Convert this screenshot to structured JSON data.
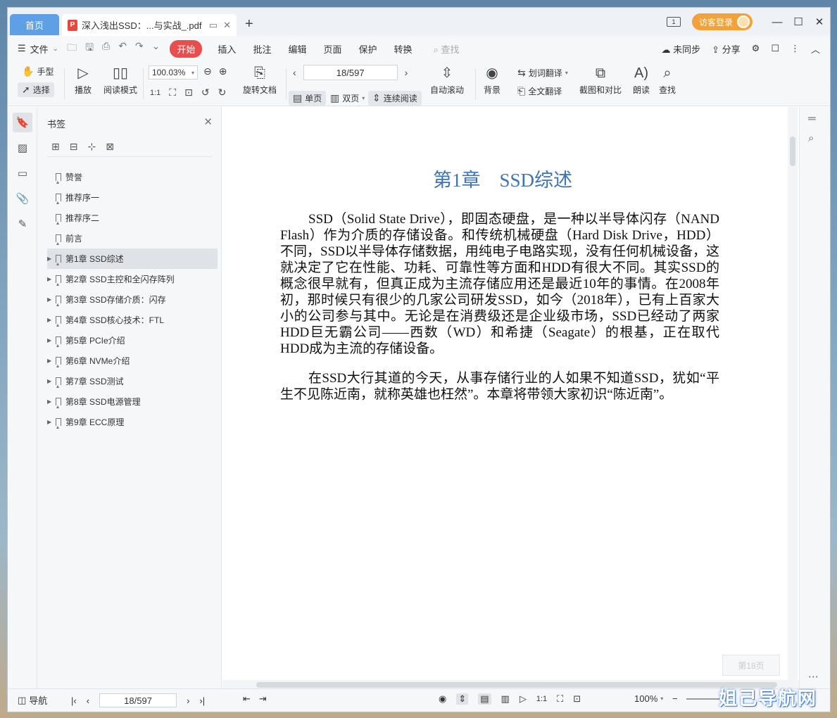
{
  "tabs": {
    "home": "首页",
    "doc_title": "深入浅出SSD：...与实战_.pdf",
    "new_tab": "+"
  },
  "titlebar": {
    "window_badge": "1",
    "guest_login": "访客登录",
    "minimize": "—",
    "maximize": "☐",
    "close": "✕"
  },
  "menu": {
    "file": "文件",
    "start": "开始",
    "items": [
      "插入",
      "批注",
      "编辑",
      "页面",
      "保护",
      "转换"
    ],
    "search": "查找",
    "not_synced": "未同步",
    "share": "分享"
  },
  "toolbar": {
    "hand": "手型",
    "select": "选择",
    "play": "播放",
    "read_mode": "阅读模式",
    "zoom": "100.03%",
    "rotate_doc": "旋转文档",
    "page_display": "18/597",
    "single_page": "单页",
    "double_page": "双页",
    "continuous": "连续阅读",
    "auto_scroll": "自动滚动",
    "background": "背景",
    "word_translate": "划词翻译",
    "full_translate": "全文翻译",
    "screenshot_compare": "截图和对比",
    "read_aloud": "朗读",
    "find": "查找"
  },
  "bookmarks": {
    "title": "书签",
    "items": [
      {
        "label": "赞誉",
        "expandable": false,
        "selected": false
      },
      {
        "label": "推荐序一",
        "expandable": false,
        "selected": false
      },
      {
        "label": "推荐序二",
        "expandable": false,
        "selected": false
      },
      {
        "label": "前言",
        "expandable": false,
        "selected": false
      },
      {
        "label": "第1章 SSD综述",
        "expandable": true,
        "selected": true
      },
      {
        "label": "第2章 SSD主控和全闪存阵列",
        "expandable": true,
        "selected": false
      },
      {
        "label": "第3章 SSD存储介质：闪存",
        "expandable": true,
        "selected": false
      },
      {
        "label": "第4章 SSD核心技术：FTL",
        "expandable": true,
        "selected": false
      },
      {
        "label": "第5章 PCIe介绍",
        "expandable": true,
        "selected": false
      },
      {
        "label": "第6章 NVMe介绍",
        "expandable": true,
        "selected": false
      },
      {
        "label": "第7章 SSD测试",
        "expandable": true,
        "selected": false
      },
      {
        "label": "第8章 SSD电源管理",
        "expandable": true,
        "selected": false
      },
      {
        "label": "第9章 ECC原理",
        "expandable": true,
        "selected": false
      }
    ]
  },
  "document": {
    "chapter_title": "第1章　SSD综述",
    "paragraph1": "SSD（Solid State Drive），即固态硬盘，是一种以半导体闪存（NAND Flash）作为介质的存储设备。和传统机械硬盘（Hard Disk Drive，HDD）不同，SSD以半导体存储数据，用纯电子电路实现，没有任何机械设备，这就决定了它在性能、功耗、可靠性等方面和HDD有很大不同。其实SSD的概念很早就有，但真正成为主流存储应用还是最近10年的事情。在2008年初，那时候只有很少的几家公司研发SSD，如今（2018年），已有上百家大小的公司参与其中。无论是在消费级还是企业级市场，SSD已经动了两家HDD巨无霸公司——西数（WD）和希捷（Seagate）的根基，正在取代HDD成为主流的存储设备。",
    "paragraph2": "在SSD大行其道的今天，从事存储行业的人如果不知道SSD，犹如“平生不见陈近南，就称英雄也枉然”。本章将带领大家初识“陈近南”。",
    "page_badge": "第18页"
  },
  "statusbar": {
    "nav": "导航",
    "page": "18/597",
    "zoom": "100%"
  },
  "watermark": "姐己导航网",
  "colors": {
    "accent": "#5f9fe6",
    "start_button": "#e84e4e",
    "guest_login": "#f3a23a",
    "chapter_title": "#3b74b8"
  }
}
